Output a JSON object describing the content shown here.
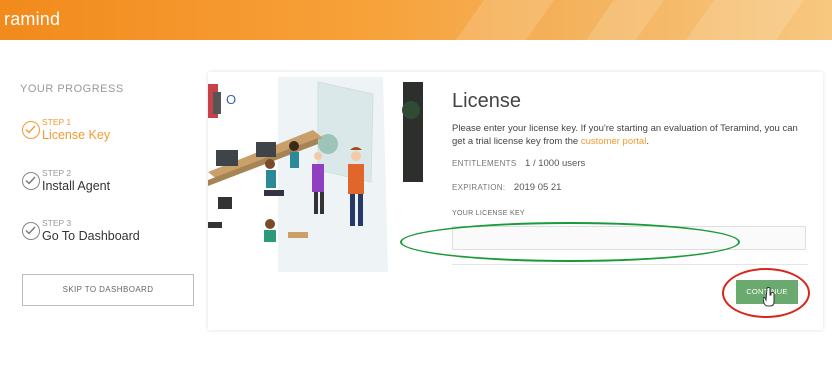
{
  "header": {
    "brand": "ramind"
  },
  "sidebar": {
    "progress_title": "YOUR PROGRESS",
    "steps": [
      {
        "number": "STEP 1",
        "label": "License Key",
        "state": "active"
      },
      {
        "number": "STEP 2",
        "label": "Install Agent",
        "state": "done"
      },
      {
        "number": "STEP 3",
        "label": "Go To Dashboard",
        "state": "done"
      }
    ],
    "skip_label": "SKIP TO DASHBOARD"
  },
  "license": {
    "title": "License",
    "description": "Please enter your license key. If you're starting an evaluation of Teramind, you can get a trial license key from the ",
    "portal_link": "customer portal",
    "description_end": ".",
    "entitlements_label": "ENTITLEMENTS",
    "entitlements_value": "1 / 1000 users",
    "expiration_label": "EXPIRATION:",
    "expiration_value": "2019 05 21",
    "key_label": "YOUR LICENSE KEY",
    "key_value": "",
    "continue_label": "CONTINUE"
  },
  "colors": {
    "brand_orange": "#f28a1c",
    "accent_orange": "#f29a32",
    "continue_green": "#6aaa6e",
    "highlight_green": "#1a9a3a",
    "highlight_red": "#d9261c"
  }
}
